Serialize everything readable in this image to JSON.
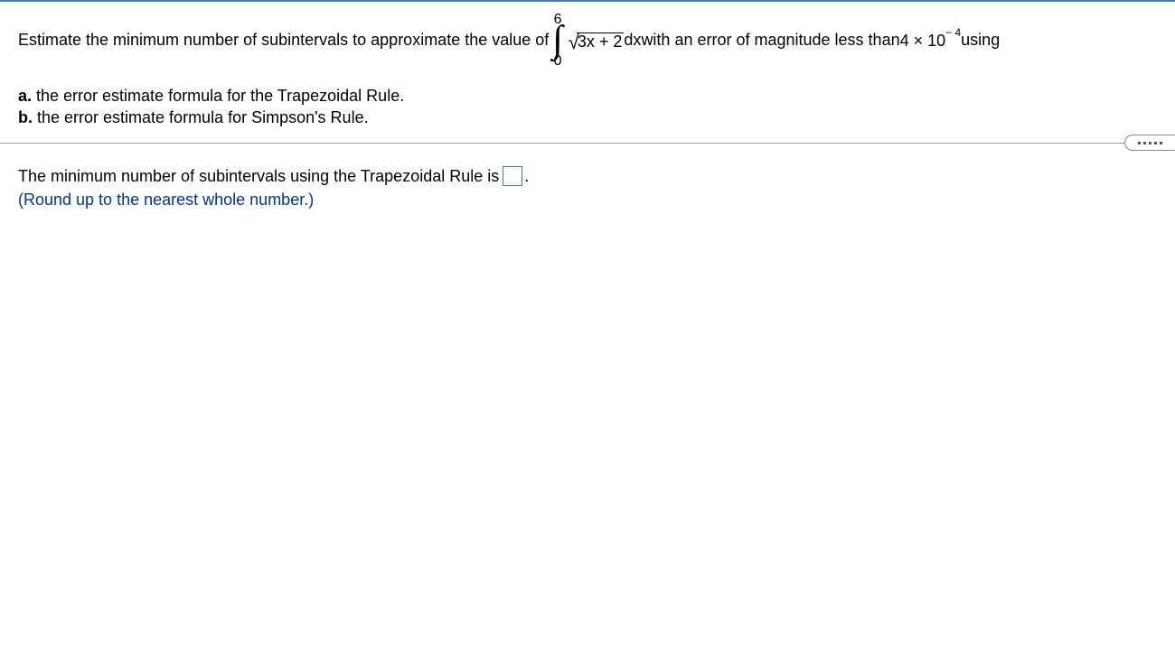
{
  "question": {
    "intro": "Estimate the minimum number of subintervals to approximate the value of ",
    "integral": {
      "upper": "6",
      "lower": "0",
      "radicand": "3x + 2",
      "dx": " dx"
    },
    "mid": " with an error of magnitude less than ",
    "error_coef": "4",
    "error_times": " × 10",
    "error_exp": "− 4",
    "tail": " using",
    "part_a_label": "a.",
    "part_a_text": " the error estimate formula for the Trapezoidal Rule.",
    "part_b_label": "b.",
    "part_b_text": " the error estimate formula for Simpson's Rule."
  },
  "answer": {
    "prompt_before": "The minimum number of subintervals using the Trapezoidal Rule is ",
    "value": "",
    "prompt_after": ".",
    "hint": "(Round up to the nearest whole number.)"
  }
}
